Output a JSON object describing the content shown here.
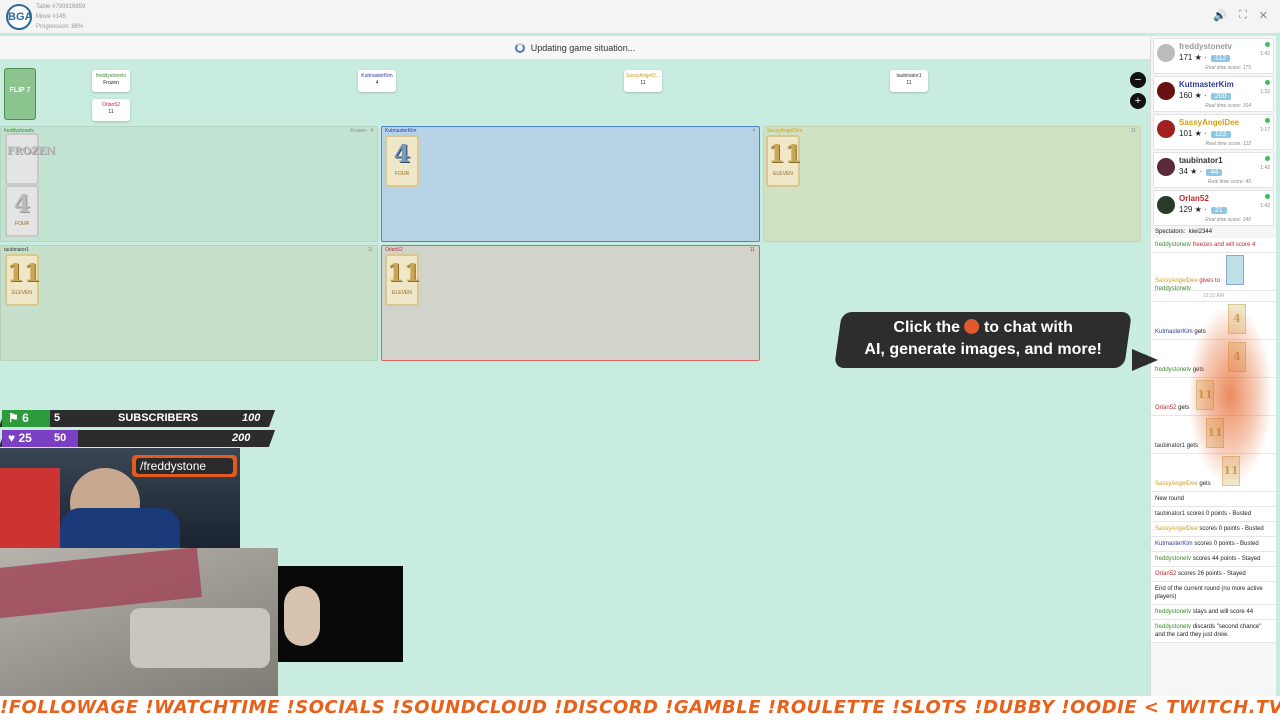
{
  "header": {
    "line1": "Table #790816859",
    "line2": "Move #145",
    "line3": "Progression: 86%",
    "logo_text": "BGA"
  },
  "status": {
    "text": "Updating game situation..."
  },
  "tags": [
    {
      "name": "freddystonetv",
      "sub": "Frozen",
      "color": "#3a8a2e"
    },
    {
      "name": "KutmasterKim",
      "sub": "4",
      "color": "#2a3aa0"
    },
    {
      "name": "SassyAngelD...",
      "sub": "11",
      "color": "#d4a017"
    },
    {
      "name": "taubinator1",
      "sub": "11",
      "color": "#333333"
    },
    {
      "name": "Orlan52",
      "sub": "11",
      "color": "#c0282c"
    }
  ],
  "deck": {
    "label": "FLIP 7"
  },
  "zones": {
    "freddy": {
      "name": "freddystonetv",
      "score": "Frozen · 4"
    },
    "kim": {
      "name": "KutmasterKim",
      "score": "4"
    },
    "sassy": {
      "name": "SassyAngelDee",
      "score": "11"
    },
    "taub": {
      "name": "taubinator1",
      "score": "11"
    },
    "orlan": {
      "name": "Orlan52",
      "score": "11"
    }
  },
  "cards": {
    "four": "4",
    "four_word": "FOUR",
    "eleven": "11",
    "eleven_word": "ELEVEN",
    "frozen": "FROZEN"
  },
  "players": [
    {
      "name": "freddystonetv",
      "score": "171",
      "pill": "112",
      "real": "Real time score: 175",
      "time": "1:42",
      "color": "#999999"
    },
    {
      "name": "KutmasterKim",
      "score": "160",
      "pill": "200",
      "real": "Real time score: 164",
      "time": "1:32",
      "color": "#2a3aa0"
    },
    {
      "name": "SassyAngelDee",
      "score": "101",
      "pill": "122",
      "real": "Real time score: 112",
      "time": "1:17",
      "color": "#d4a017"
    },
    {
      "name": "taubinator1",
      "score": "34",
      "pill": "44",
      "real": "Real time score: 45",
      "time": "1:42",
      "color": "#333333"
    },
    {
      "name": "Orlan52",
      "score": "129",
      "pill": "21",
      "real": "Real time score: 140",
      "time": "1:42",
      "color": "#c0282c"
    }
  ],
  "spectators": {
    "label": "Spectators:",
    "names": "kiwi2344"
  },
  "log": {
    "freezes": {
      "name": "freddystonetv",
      "text": " freezes and will score 4"
    },
    "gives": {
      "name": "SassyAngelDee",
      "mid": " gives ",
      "to": " to ",
      "target": "freddystonetv"
    },
    "time": "12:31 AM",
    "gets": [
      {
        "name": "KutmasterKim",
        "text": " gets",
        "card": "4"
      },
      {
        "name": "freddystonetv",
        "text": " gets",
        "card": "4"
      },
      {
        "name": "Orlan52",
        "text": " gets",
        "card": "11"
      },
      {
        "name": "taubinator1",
        "text": " gets",
        "card": "11"
      },
      {
        "name": "SassyAngelDee",
        "text": " gets",
        "card": "11"
      }
    ],
    "new_round": "New round",
    "scores": [
      {
        "name": "taubinator1",
        "text": " scores 0 points - Busted"
      },
      {
        "name": "SassyAngelDee",
        "text": " scores 0 points - Busted"
      },
      {
        "name": "KutmasterKim",
        "text": " scores 0 points - Busted"
      },
      {
        "name": "freddystonetv",
        "text": " scores 44 points - Stayed"
      },
      {
        "name": "Orlan52",
        "text": " scores 26 points - Stayed"
      }
    ],
    "end_round": "End of the current round (no more active players)",
    "stays": {
      "name": "freddystonetv",
      "text": " stays and will score 44"
    },
    "discards": {
      "name": "freddystonetv",
      "text": " discards \"second chance\" and the card they just drew."
    }
  },
  "callout": {
    "line1a": "Click the",
    "line1b": "to chat with",
    "line2": "AI, generate images, and more!"
  },
  "stream": {
    "row1_a": "6",
    "row1_b": "5",
    "row1_label": "SUBSCRIBERS",
    "row1_goal": "100",
    "row2_a": "25",
    "row2_b": "50",
    "row2_goal": "200",
    "handle": "/freddystone"
  },
  "ticker": "!FOLLOWAGE !WATCHTIME !SOCIALS !SOUNDCLOUD !DISCORD !GAMBLE !ROULETTE !SLOTS !DUBBY !OODIE < TWITCH.TV/FREDDYSTONE"
}
